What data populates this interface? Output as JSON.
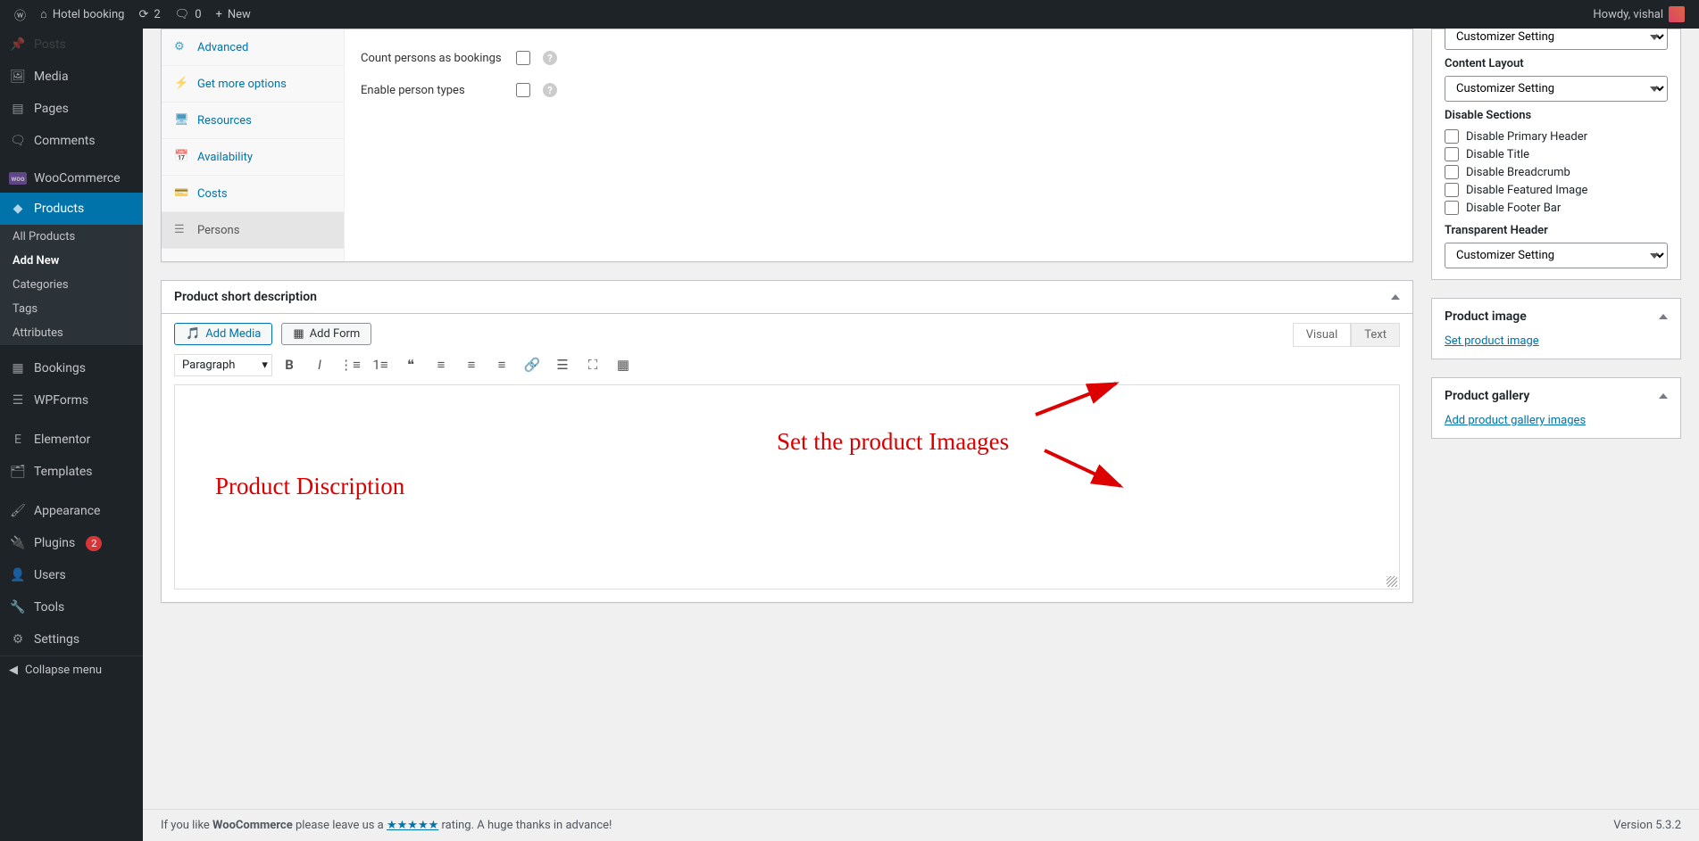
{
  "adminbar": {
    "site_name": "Hotel booking",
    "updates_count": "2",
    "comments_count": "0",
    "new_label": "New",
    "howdy": "Howdy, vishal"
  },
  "sidebar": {
    "items": [
      {
        "label": "Posts",
        "icon": "pin"
      },
      {
        "label": "Media",
        "icon": "media"
      },
      {
        "label": "Pages",
        "icon": "pages"
      },
      {
        "label": "Comments",
        "icon": "comment"
      },
      {
        "label": "WooCommerce",
        "icon": "woo"
      },
      {
        "label": "Products",
        "icon": "archive",
        "open": true
      },
      {
        "label": "Bookings",
        "icon": "calendar"
      },
      {
        "label": "WPForms",
        "icon": "forms"
      },
      {
        "label": "Elementor",
        "icon": "elementor"
      },
      {
        "label": "Templates",
        "icon": "templates"
      },
      {
        "label": "Appearance",
        "icon": "appearance"
      },
      {
        "label": "Plugins",
        "icon": "plugins",
        "badge": "2"
      },
      {
        "label": "Users",
        "icon": "users"
      },
      {
        "label": "Tools",
        "icon": "tools"
      },
      {
        "label": "Settings",
        "icon": "settings"
      }
    ],
    "submenu": [
      {
        "label": "All Products"
      },
      {
        "label": "Add New",
        "current": true
      },
      {
        "label": "Categories"
      },
      {
        "label": "Tags"
      },
      {
        "label": "Attributes"
      }
    ],
    "collapse": "Collapse menu"
  },
  "pd_tabs": [
    {
      "label": "Advanced",
      "icon": "gear"
    },
    {
      "label": "Get more options",
      "icon": "bolt"
    },
    {
      "label": "Resources",
      "icon": "monitor"
    },
    {
      "label": "Availability",
      "icon": "cal"
    },
    {
      "label": "Costs",
      "icon": "card"
    },
    {
      "label": "Persons",
      "icon": "list",
      "active": true
    }
  ],
  "pd_fields": {
    "count_persons": "Count persons as bookings",
    "enable_types": "Enable person types"
  },
  "short_desc": {
    "title": "Product short description",
    "add_media": "Add Media",
    "add_form": "Add Form",
    "visual": "Visual",
    "text": "Text",
    "paragraph": "Paragraph"
  },
  "side": {
    "layout_select": "Customizer Setting",
    "content_layout": "Content Layout",
    "disable_sections": "Disable Sections",
    "disables": [
      "Disable Primary Header",
      "Disable Title",
      "Disable Breadcrumb",
      "Disable Featured Image",
      "Disable Footer Bar"
    ],
    "transparent_header": "Transparent Header",
    "product_image_title": "Product image",
    "set_product_image": "Set product image",
    "product_gallery_title": "Product gallery",
    "add_gallery": "Add product gallery images"
  },
  "annotations": {
    "set_images": "Set the product Imaages",
    "product_desc": "Product Discription"
  },
  "footer": {
    "text_pre": "If you like ",
    "woo": "WooCommerce",
    "text_mid": " please leave us a ",
    "stars": "★★★★★",
    "text_post": " rating. A huge thanks in advance!",
    "version": "Version 5.3.2"
  }
}
